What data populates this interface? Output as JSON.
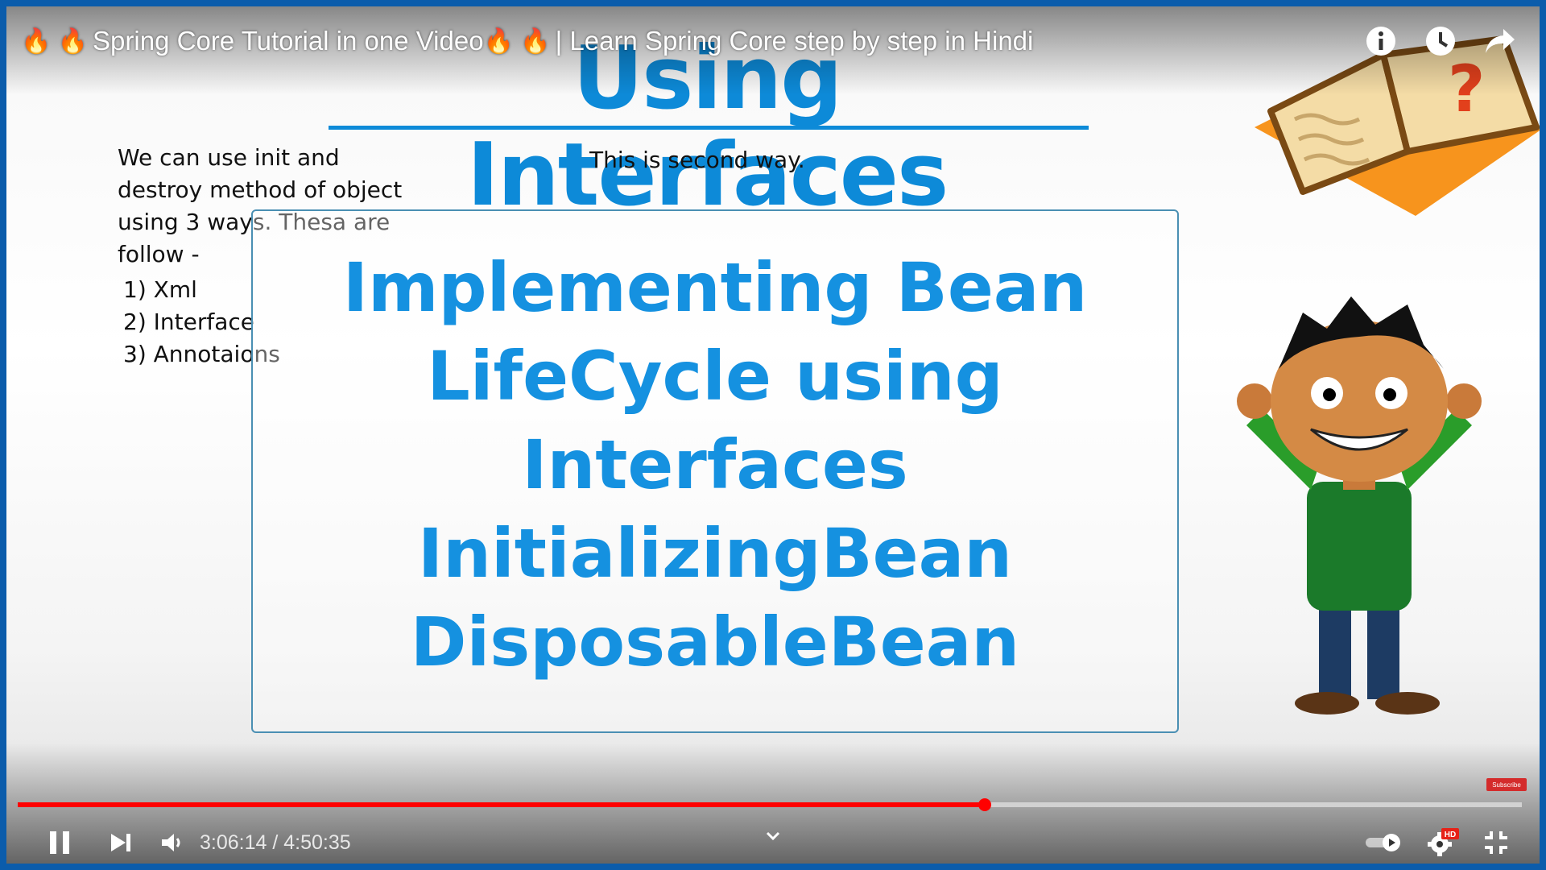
{
  "video_title": {
    "flames_left": "🔥 🔥",
    "text": "Spring Core Tutorial in one Video",
    "flames_right": "🔥 🔥",
    "suffix": " | Learn Spring Core step by step in Hindi"
  },
  "slide": {
    "title": "Using Interfaces",
    "intro_lines": [
      "We can use init and",
      "destroy method of object",
      "using 3 ways. Thesa are",
      "follow -"
    ],
    "ways": [
      "1) Xml",
      "2) Interface",
      "3) Annotaions"
    ],
    "note": "This is second way.",
    "box_lines": [
      "Implementing Bean",
      "LifeCycle using",
      "Interfaces",
      "InitializingBean",
      "DisposableBean"
    ]
  },
  "top_icons": [
    "info-icon",
    "watch-later-icon",
    "share-icon"
  ],
  "player": {
    "current_time": "3:06:14",
    "separator": " / ",
    "duration": "4:50:35",
    "progress": 0.643,
    "subscribe_label": "Subscribe",
    "quality_badge": "HD",
    "accent": "#ff0000"
  }
}
